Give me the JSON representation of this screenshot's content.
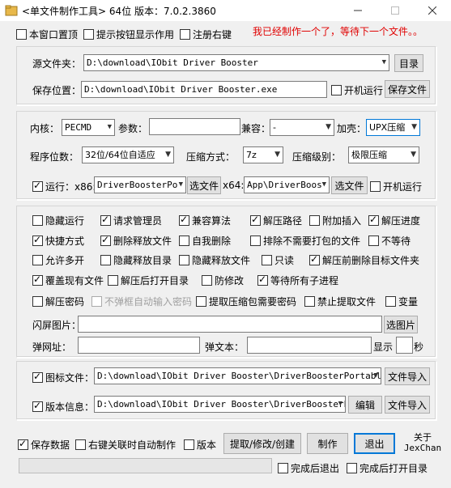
{
  "window": {
    "title": "<单文件制作工具> 64位 版本：7.0.2.3860",
    "minimize_icon": "minimize-icon",
    "maximize_icon": "maximize-icon",
    "close_icon": "close-icon"
  },
  "top_options": {
    "always_on_top": "本窗口置顶",
    "show_hints": "提示按钮显示作用",
    "register_right_click": "注册右键"
  },
  "status_message": "我已经制作一个了，等待下一个文件。。",
  "source": {
    "label": "源文件夹：",
    "value": "D:\\download\\IObit Driver Booster",
    "browse_button": "目录"
  },
  "save": {
    "label": "保存位置：",
    "value": "D:\\download\\IObit Driver Booster.exe",
    "startup_run": "开机运行",
    "save_file_button": "保存文件"
  },
  "kernel": {
    "label": "内核：",
    "value": "PECMD",
    "params_label": "参数：",
    "params_value": "",
    "compat_label": "兼容：",
    "compat_value": "-",
    "shell_label": "加壳：",
    "shell_value": "UPX压缩"
  },
  "program": {
    "bits_label": "程序位数：",
    "bits_value": "32位/64位自适应",
    "compress_label": "压缩方式：",
    "compress_value": "7z",
    "level_label": "压缩级别：",
    "level_value": "极限压缩"
  },
  "run": {
    "label": "运行：x86:",
    "x86_value": "DriverBoosterPo",
    "x86_button": "选文件",
    "x64_label": "x64:",
    "x64_value": "App\\DriverBoos",
    "x64_button": "选文件",
    "startup_run": "开机运行"
  },
  "options": [
    [
      {
        "label": "隐藏运行",
        "checked": false
      },
      {
        "label": "请求管理员",
        "checked": true
      },
      {
        "label": "兼容算法",
        "checked": true
      },
      {
        "label": "解压路径",
        "checked": true
      },
      {
        "label": "附加插入",
        "checked": false
      },
      {
        "label": "解压进度",
        "checked": true
      }
    ],
    [
      {
        "label": "快捷方式",
        "checked": true
      },
      {
        "label": "删除释放文件",
        "checked": true
      },
      {
        "label": "自我删除",
        "checked": false
      },
      {
        "label": "排除不需要打包的文件",
        "checked": false
      },
      {
        "label": "不等待",
        "checked": false
      }
    ],
    [
      {
        "label": "允许多开",
        "checked": false
      },
      {
        "label": "隐藏释放目录",
        "checked": false
      },
      {
        "label": "隐藏释放文件",
        "checked": false
      },
      {
        "label": "只读",
        "checked": false
      },
      {
        "label": "解压前删除目标文件夹",
        "checked": true
      }
    ],
    [
      {
        "label": "覆盖现有文件",
        "checked": true
      },
      {
        "label": "解压后打开目录",
        "checked": false
      },
      {
        "label": "防修改",
        "checked": false
      },
      {
        "label": "等待所有子进程",
        "checked": true
      }
    ],
    [
      {
        "label": "解压密码",
        "checked": false
      },
      {
        "label": "不弹框自动输入密码",
        "checked": false,
        "disabled": true
      },
      {
        "label": "提取压缩包需要密码",
        "checked": false
      },
      {
        "label": "禁止提取文件",
        "checked": false
      },
      {
        "label": "变量",
        "checked": false
      }
    ]
  ],
  "splash": {
    "label": "闪屏图片：",
    "value": "",
    "button": "选图片"
  },
  "popup": {
    "url_label": "弹网址：",
    "url_value": "",
    "text_label": "弹文本：",
    "text_value": "",
    "show_label": "显示",
    "seconds_value": "",
    "seconds_label": "秒"
  },
  "icon_file": {
    "label": "图标文件：",
    "checked": true,
    "value": "D:\\download\\IObit Driver Booster\\DriverBoosterPortable.",
    "import_button": "文件导入"
  },
  "version_info": {
    "label": "版本信息：",
    "checked": true,
    "value": "D:\\download\\IObit Driver Booster\\DriverBoosterPo",
    "edit_button": "编辑",
    "import_button": "文件导入"
  },
  "bottom": {
    "save_data": "保存数据",
    "save_data_checked": true,
    "auto_make": "右键关联时自动制作",
    "version": "版本",
    "extract_button": "提取/修改/创建",
    "make_button": "制作",
    "exit_button": "退出",
    "about_line1": "关于",
    "about_line2": "JexChan",
    "exit_after_done": "完成后退出",
    "open_after_done": "完成后打开目录",
    "progress": 0
  }
}
